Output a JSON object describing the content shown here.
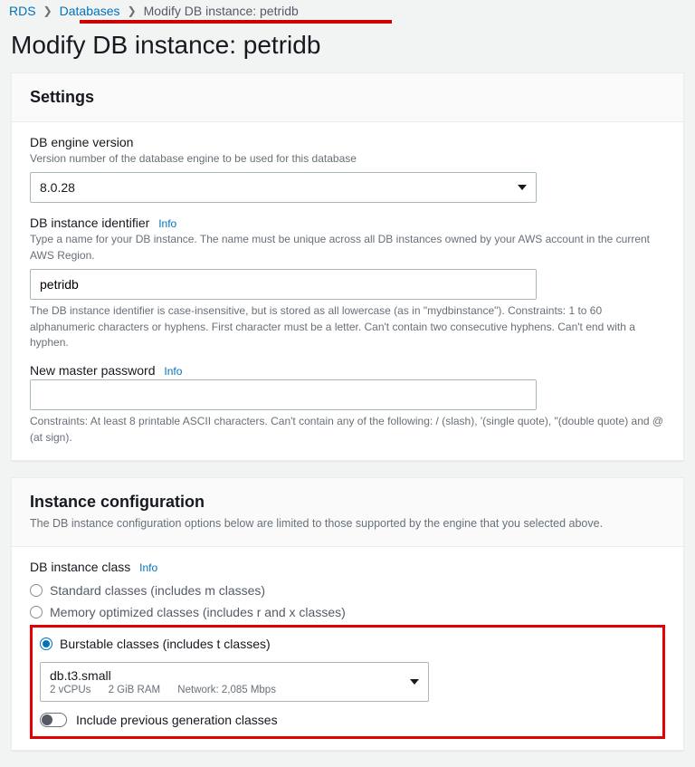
{
  "breadcrumb": {
    "rds": "RDS",
    "databases": "Databases",
    "current": "Modify DB instance: petridb"
  },
  "pageTitle": "Modify DB instance: petridb",
  "settings": {
    "header": "Settings",
    "engineVersion": {
      "label": "DB engine version",
      "desc": "Version number of the database engine to be used for this database",
      "value": "8.0.28"
    },
    "identifier": {
      "label": "DB instance identifier",
      "info": "Info",
      "desc": "Type a name for your DB instance. The name must be unique across all DB instances owned by your AWS account in the current AWS Region.",
      "value": "petridb",
      "help": "The DB instance identifier is case-insensitive, but is stored as all lowercase (as in \"mydbinstance\"). Constraints: 1 to 60 alphanumeric characters or hyphens. First character must be a letter. Can't contain two consecutive hyphens. Can't end with a hyphen."
    },
    "masterPassword": {
      "label": "New master password",
      "info": "Info",
      "value": "",
      "help": "Constraints: At least 8 printable ASCII characters. Can't contain any of the following: / (slash), '(single quote), \"(double quote) and @ (at sign)."
    }
  },
  "instanceConfig": {
    "header": "Instance configuration",
    "sub": "The DB instance configuration options below are limited to those supported by the engine that you selected above.",
    "classLabel": "DB instance class",
    "info": "Info",
    "options": {
      "standard": "Standard classes (includes m classes)",
      "memory": "Memory optimized classes (includes r and x classes)",
      "burstable": "Burstable classes (includes t classes)"
    },
    "selected": {
      "name": "db.t3.small",
      "vcpus": "2 vCPUs",
      "ram": "2 GiB RAM",
      "network": "Network: 2,085 Mbps"
    },
    "toggleLabel": "Include previous generation classes"
  }
}
